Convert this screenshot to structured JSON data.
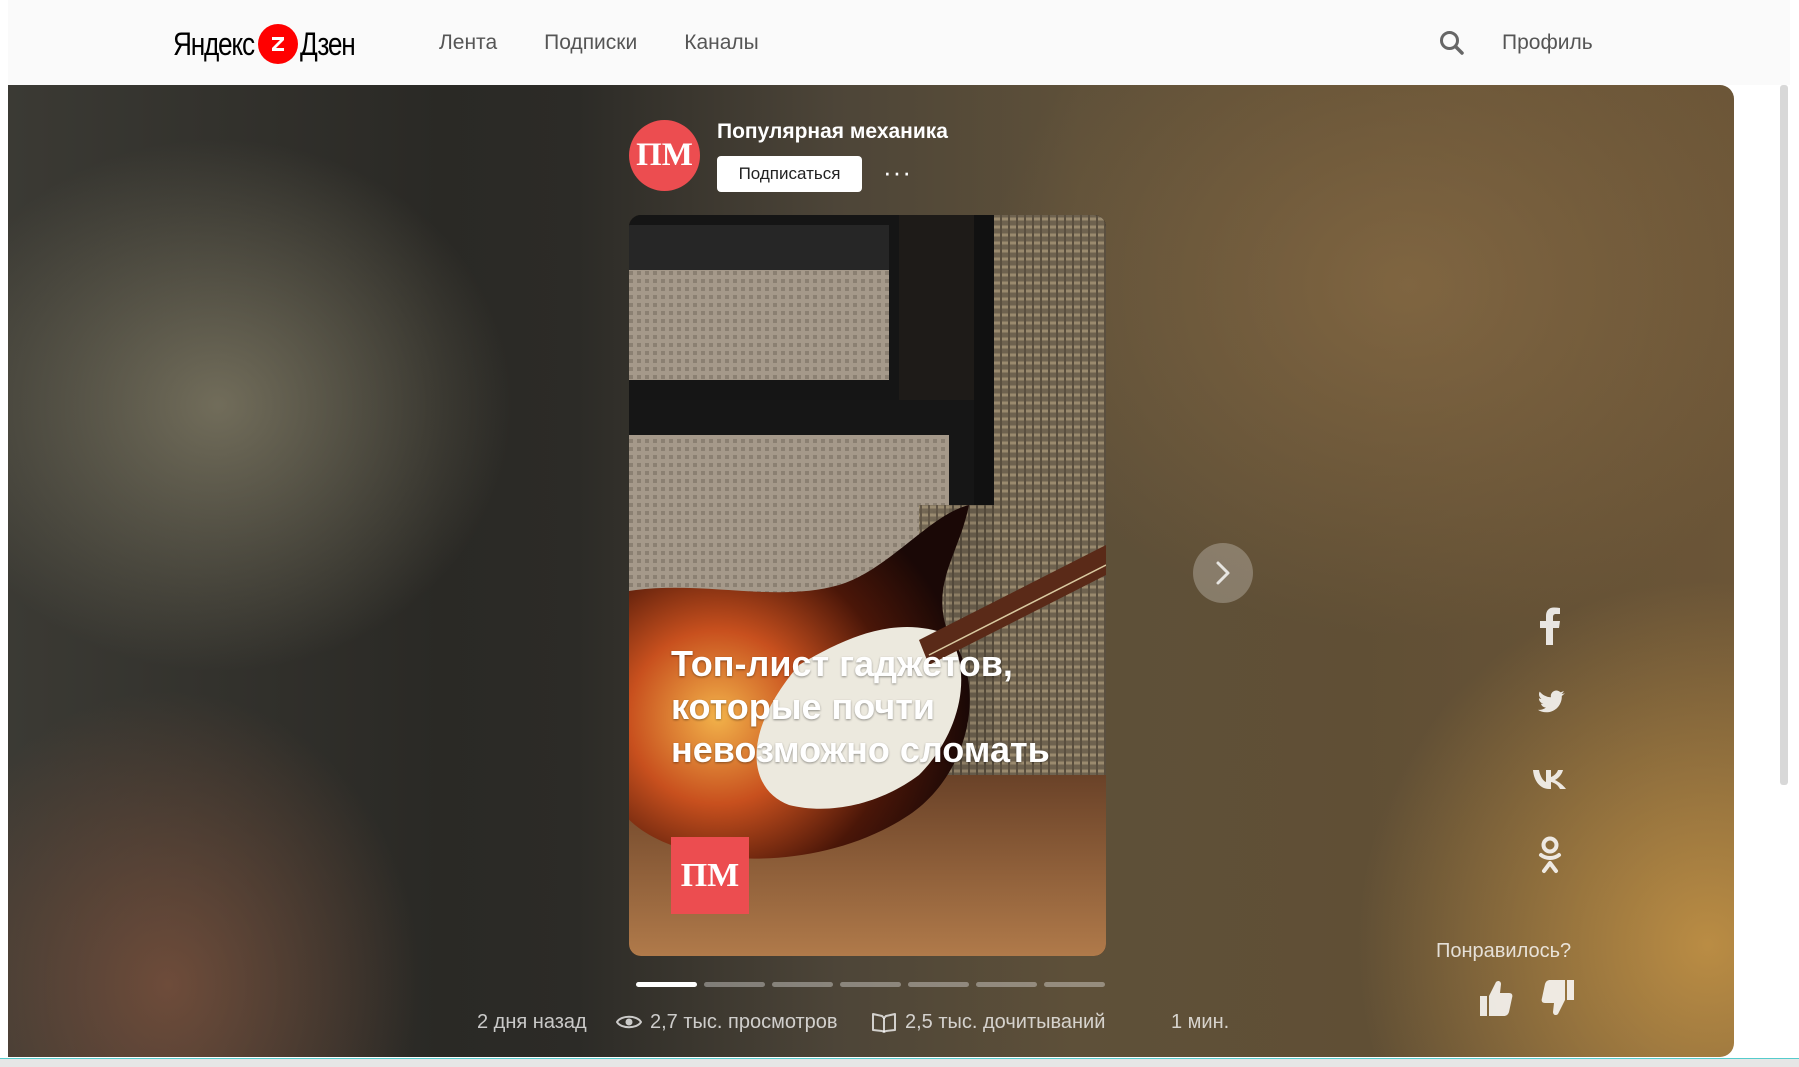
{
  "header": {
    "logo": {
      "yandex": "Яндекс",
      "dzen": "Дзен"
    },
    "nav": [
      "Лента",
      "Подписки",
      "Каналы"
    ],
    "profile": "Профиль"
  },
  "channel": {
    "avatar_text": "ПМ",
    "name": "Популярная механика",
    "subscribe": "Подписаться",
    "more": "···"
  },
  "story": {
    "title": "Топ-лист гаджетов, которые почти невозможно сломать",
    "logo_text": "ПМ",
    "progress": {
      "total": 7,
      "current": 1
    }
  },
  "stats": {
    "ago": "2 дня назад",
    "views": "2,7 тыс. просмотров",
    "reads": "2,5 тыс. дочитываний",
    "duration": "1 мин."
  },
  "share": [
    "facebook-icon",
    "twitter-icon",
    "vk-icon",
    "odnoklassniki-icon"
  ],
  "feedback": {
    "label": "Понравилось?"
  },
  "colors": {
    "brand_red": "#ec4d50",
    "logo_red": "#ff0000"
  }
}
